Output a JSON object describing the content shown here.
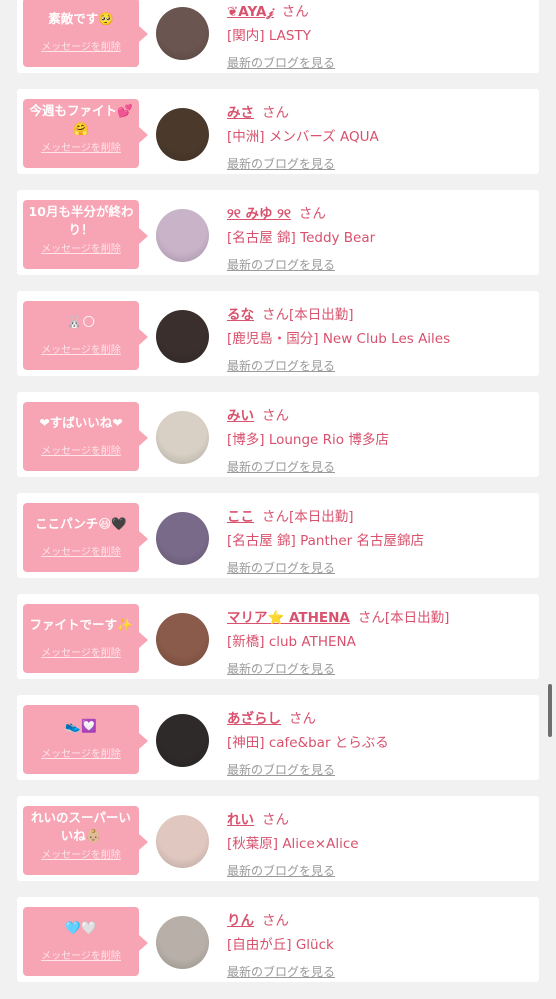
{
  "cards": [
    {
      "message": "素敵です🥺",
      "delete_label": "メッセージを削除",
      "name": "❦AYA𝒿",
      "san": "さん",
      "work_status": "",
      "shop": "[関内] LASTY",
      "blog_label": "最新のブログを見る",
      "avatar_color": "#6b5550"
    },
    {
      "message": "今週もファイト💕🤗",
      "delete_label": "メッセージを削除",
      "name": "みさ",
      "san": "さん",
      "work_status": "",
      "shop": "[中洲] メンバーズ AQUA",
      "blog_label": "最新のブログを見る",
      "avatar_color": "#4b3a2c"
    },
    {
      "message": "10月も半分が終わり！",
      "delete_label": "メッセージを削除",
      "name": "୨୧ みゆ ୨୧",
      "san": "さん",
      "work_status": "",
      "shop": "[名古屋 錦] Teddy Bear",
      "blog_label": "最新のブログを見る",
      "avatar_color": "#c9b3c9"
    },
    {
      "message": "🐰🌕",
      "delete_label": "メッセージを削除",
      "name": "るな",
      "san": "さん",
      "work_status": "[本日出勤]",
      "shop": "[鹿児島・国分] New Club Les Ailes",
      "blog_label": "最新のブログを見る",
      "avatar_color": "#3a2f2c"
    },
    {
      "message": "❤すばいいね❤",
      "delete_label": "メッセージを削除",
      "name": "みい",
      "san": "さん",
      "work_status": "",
      "shop": "[博多] Lounge Rio 博多店",
      "blog_label": "最新のブログを見る",
      "avatar_color": "#d8d0c4"
    },
    {
      "message": "ここパンチ😆🖤",
      "delete_label": "メッセージを削除",
      "name": "ここ",
      "san": "さん",
      "work_status": "[本日出勤]",
      "shop": "[名古屋 錦] Panther 名古屋錦店",
      "blog_label": "最新のブログを見る",
      "avatar_color": "#7a6a8a"
    },
    {
      "message": "ファイトでーす✨",
      "delete_label": "メッセージを削除",
      "name": "マリア⭐️ ATHENA",
      "san": "さん",
      "work_status": "[本日出勤]",
      "shop": "[新橋] club ATHENA",
      "blog_label": "最新のブログを見る",
      "avatar_color": "#8a5a4a"
    },
    {
      "message": "👟💟",
      "delete_label": "メッセージを削除",
      "name": "あざらし",
      "san": "さん",
      "work_status": "",
      "shop": "[神田] cafe&bar とらぶる",
      "blog_label": "最新のブログを見る",
      "avatar_color": "#2e2a2a"
    },
    {
      "message": "れいのスーパーいいね👶🏼",
      "delete_label": "メッセージを削除",
      "name": "れい",
      "san": "さん",
      "work_status": "",
      "shop": "[秋葉原] Alice×Alice",
      "blog_label": "最新のブログを見る",
      "avatar_color": "#e0c8c0"
    },
    {
      "message": "🩵🤍",
      "delete_label": "メッセージを削除",
      "name": "りん",
      "san": "さん",
      "work_status": "",
      "shop": "[自由が丘] Glück",
      "blog_label": "最新のブログを見る",
      "avatar_color": "#b8b0a8"
    }
  ]
}
